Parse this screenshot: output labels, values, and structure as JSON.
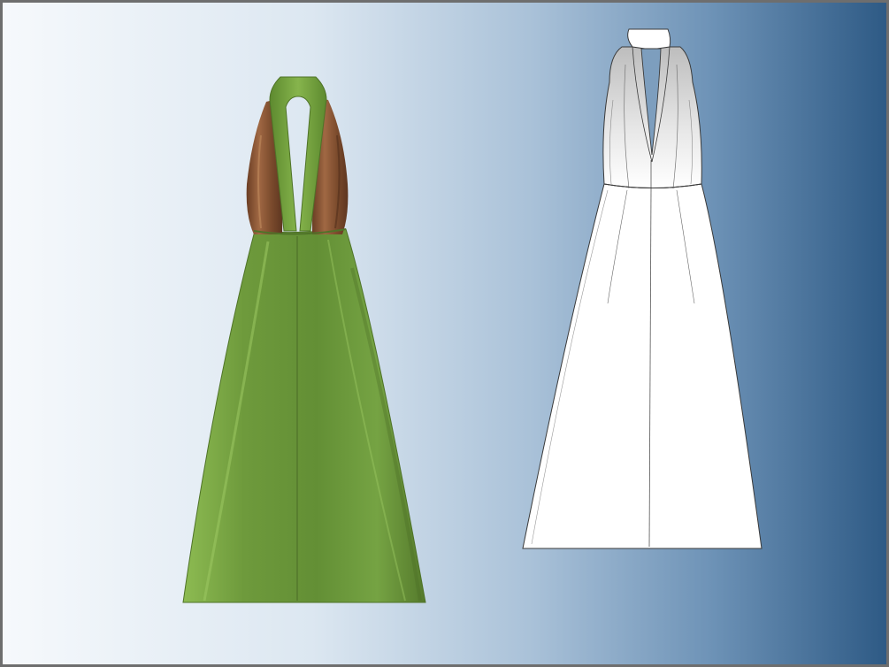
{
  "scene": {
    "description_hidden": "",
    "colors": {
      "background_left": "#f6f9fc",
      "background_right": "#2e5a85",
      "frame_border": "#6e6e6e",
      "dress_green": "#6e9a3c",
      "dress_green_light": "#8dbb52",
      "dress_green_dark": "#557a2c",
      "bodice_brown": "#8a5533",
      "bodice_brown_dark": "#5e3620",
      "sketch_fill": "#ffffff",
      "sketch_line": "#3a3a3a",
      "sketch_shade": "#c9c9c9"
    },
    "icons": {
      "rendered_dress": "green-halter-gown-image",
      "flat_sketch": "white-halter-gown-sketch"
    }
  }
}
